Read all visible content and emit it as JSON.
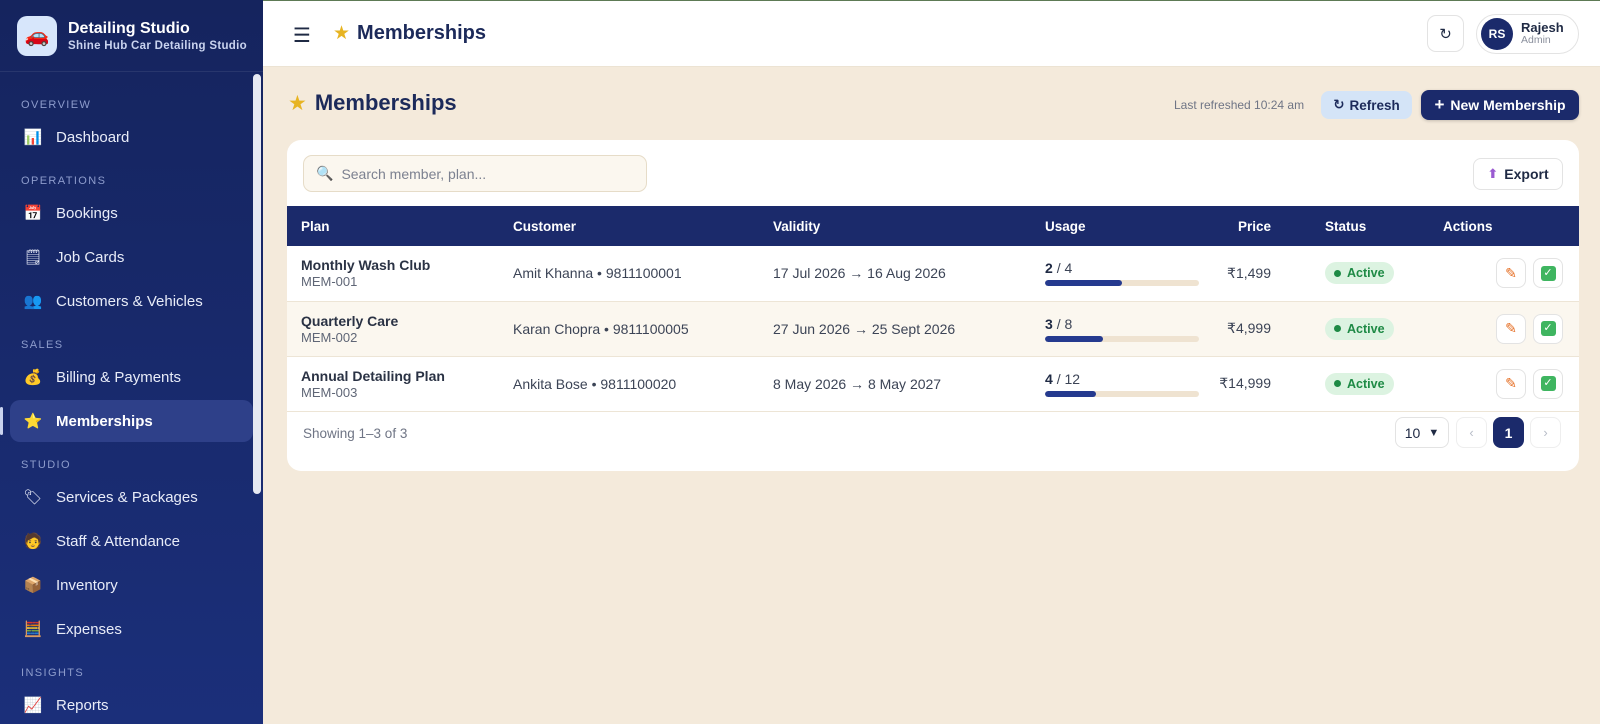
{
  "brand": {
    "title": "Detailing Studio",
    "subtitle": "Shine Hub Car Detailing Studio",
    "logo_icon": "car-icon"
  },
  "sidebar": {
    "sections": [
      {
        "label": "OVERVIEW",
        "items": [
          {
            "label": "Dashboard",
            "icon": "chart-icon",
            "glyph": "📊",
            "active": false
          }
        ]
      },
      {
        "label": "OPERATIONS",
        "items": [
          {
            "label": "Bookings",
            "icon": "calendar-icon",
            "glyph": "📅",
            "active": false
          },
          {
            "label": "Job Cards",
            "icon": "clipboard-icon",
            "glyph": "🗒",
            "active": false
          },
          {
            "label": "Customers & Vehicles",
            "icon": "people-icon",
            "glyph": "👥",
            "active": false
          }
        ]
      },
      {
        "label": "SALES",
        "items": [
          {
            "label": "Billing & Payments",
            "icon": "money-bag-icon",
            "glyph": "💰",
            "active": false
          },
          {
            "label": "Memberships",
            "icon": "star-icon",
            "glyph": "⭐",
            "active": true
          }
        ]
      },
      {
        "label": "STUDIO",
        "items": [
          {
            "label": "Services & Packages",
            "icon": "tag-icon",
            "glyph": "🏷",
            "active": false
          },
          {
            "label": "Staff & Attendance",
            "icon": "staff-icon",
            "glyph": "🧑",
            "active": false
          },
          {
            "label": "Inventory",
            "icon": "box-icon",
            "glyph": "📦",
            "active": false
          },
          {
            "label": "Expenses",
            "icon": "abacus-icon",
            "glyph": "🧮",
            "active": false
          }
        ]
      },
      {
        "label": "INSIGHTS",
        "items": [
          {
            "label": "Reports",
            "icon": "trend-chart-icon",
            "glyph": "📈",
            "active": false
          }
        ]
      }
    ]
  },
  "topbar": {
    "title": "Memberships",
    "user": {
      "initials": "RS",
      "name": "Rajesh",
      "role": "Admin"
    }
  },
  "page": {
    "title": "Memberships",
    "last_refreshed": "Last refreshed 10:24 am",
    "refresh_label": "Refresh",
    "new_label": "New Membership"
  },
  "toolbar": {
    "search_placeholder": "Search member, plan...",
    "search_value": "",
    "export_label": "Export"
  },
  "table": {
    "headers": [
      "Plan",
      "Customer",
      "Validity",
      "Usage",
      "Price",
      "Status",
      "Actions"
    ],
    "rows": [
      {
        "plan": "Monthly Wash Club",
        "code": "MEM-001",
        "customer": "Amit Khanna • 9811100001",
        "validity": "17 Jul 2026 → 16 Aug 2026",
        "used": "2",
        "total": "/ 4",
        "usage_fraction": 0.5,
        "price": "₹1,499",
        "status": "Active"
      },
      {
        "plan": "Quarterly Care",
        "code": "MEM-002",
        "customer": "Karan Chopra • 9811100005",
        "validity": "27 Jun 2026 → 25 Sept 2026",
        "used": "3",
        "total": "/ 8",
        "usage_fraction": 0.375,
        "price": "₹4,999",
        "status": "Active"
      },
      {
        "plan": "Annual Detailing Plan",
        "code": "MEM-003",
        "customer": "Ankita Bose • 9811100020",
        "validity": "8 May 2026 → 8 May 2027",
        "used": "4",
        "total": "/ 12",
        "usage_fraction": 0.333,
        "price": "₹14,999",
        "status": "Active"
      }
    ]
  },
  "footer": {
    "showing": "Showing 1–3 of 3",
    "per_page": "10",
    "current_page": "1"
  },
  "colors": {
    "sidebar": "#15245e",
    "accent": "#1b2a6b",
    "background": "#f4eadb",
    "status_active": "#1e8a45"
  }
}
